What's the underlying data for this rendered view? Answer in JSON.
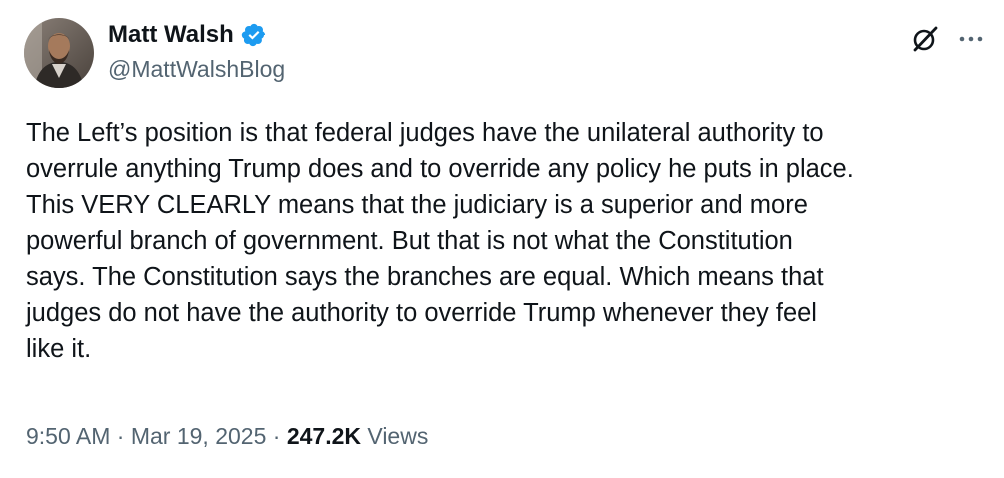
{
  "author": {
    "display_name": "Matt Walsh",
    "handle": "@MattWalshBlog",
    "verified_badge_color": "#1d9bf0",
    "avatar_icon": "profile-photo"
  },
  "header_actions": {
    "grok_icon": "grok-icon",
    "more_icon": "more-horizontal-icon"
  },
  "tweet": {
    "lines": [
      "The Left’s position is that federal judges have the unilateral authority to",
      "overrule anything Trump does and to override any policy he puts in place.",
      "This VERY CLEARLY means that the judiciary is a superior and more",
      "powerful branch of government. But that is not what the Constitution",
      "says. The Constitution says the branches are equal. Which means that",
      "judges do not have the authority to override Trump whenever they feel",
      "like it."
    ]
  },
  "meta": {
    "time": "9:50 AM",
    "separator": " · ",
    "date": "Mar 19, 2025",
    "views_count": "247.2K",
    "views_label": " Views"
  },
  "colors": {
    "text": "#0f1419",
    "secondary_text": "#536471",
    "background": "#ffffff"
  }
}
